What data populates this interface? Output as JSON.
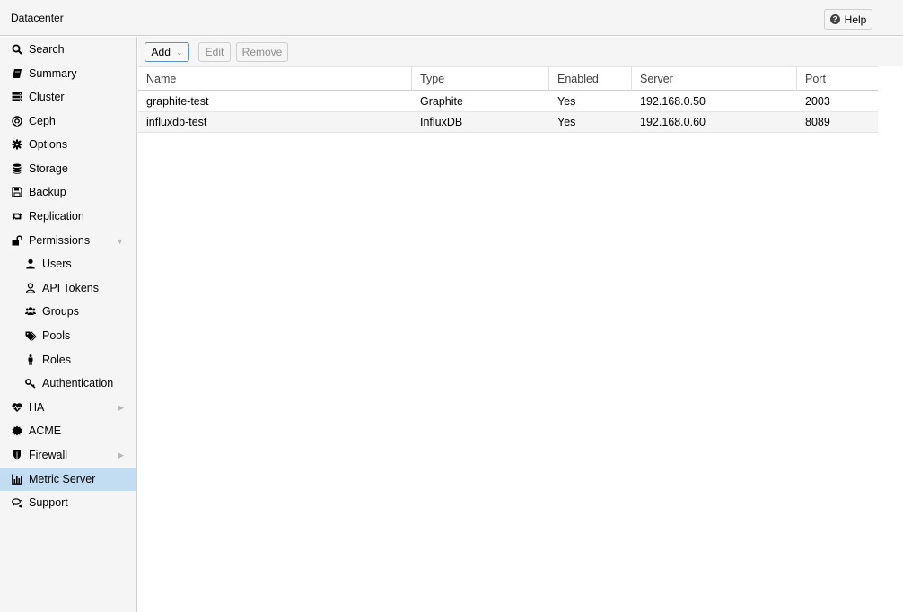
{
  "header": {
    "title": "Datacenter",
    "help_label": "Help"
  },
  "sidebar": {
    "items": [
      {
        "label": "Search",
        "icon": "search-icon"
      },
      {
        "label": "Summary",
        "icon": "book-icon"
      },
      {
        "label": "Cluster",
        "icon": "server-icon"
      },
      {
        "label": "Ceph",
        "icon": "ceph-icon"
      },
      {
        "label": "Options",
        "icon": "gear-icon"
      },
      {
        "label": "Storage",
        "icon": "database-icon"
      },
      {
        "label": "Backup",
        "icon": "floppy-icon"
      },
      {
        "label": "Replication",
        "icon": "retweet-icon"
      },
      {
        "label": "Permissions",
        "icon": "unlock-icon"
      },
      {
        "label": "Users",
        "icon": "user-icon"
      },
      {
        "label": "API Tokens",
        "icon": "user-outline-icon"
      },
      {
        "label": "Groups",
        "icon": "users-icon"
      },
      {
        "label": "Pools",
        "icon": "tags-icon"
      },
      {
        "label": "Roles",
        "icon": "male-icon"
      },
      {
        "label": "Authentication",
        "icon": "key-icon"
      },
      {
        "label": "HA",
        "icon": "heartbeat-icon"
      },
      {
        "label": "ACME",
        "icon": "certificate-icon"
      },
      {
        "label": "Firewall",
        "icon": "shield-icon"
      },
      {
        "label": "Metric Server",
        "icon": "bar-chart-icon"
      },
      {
        "label": "Support",
        "icon": "comments-icon"
      }
    ],
    "active": "Metric Server"
  },
  "toolbar": {
    "add_label": "Add",
    "edit_label": "Edit",
    "remove_label": "Remove"
  },
  "grid": {
    "columns": [
      "Name",
      "Type",
      "Enabled",
      "Server",
      "Port"
    ],
    "rows": [
      [
        "graphite-test",
        "Graphite",
        "Yes",
        "192.168.0.50",
        "2003"
      ],
      [
        "influxdb-test",
        "InfluxDB",
        "Yes",
        "192.168.0.60",
        "8089"
      ]
    ]
  },
  "colors": {
    "accent": "#c2ddf2",
    "add_border": "#5e91c4"
  }
}
